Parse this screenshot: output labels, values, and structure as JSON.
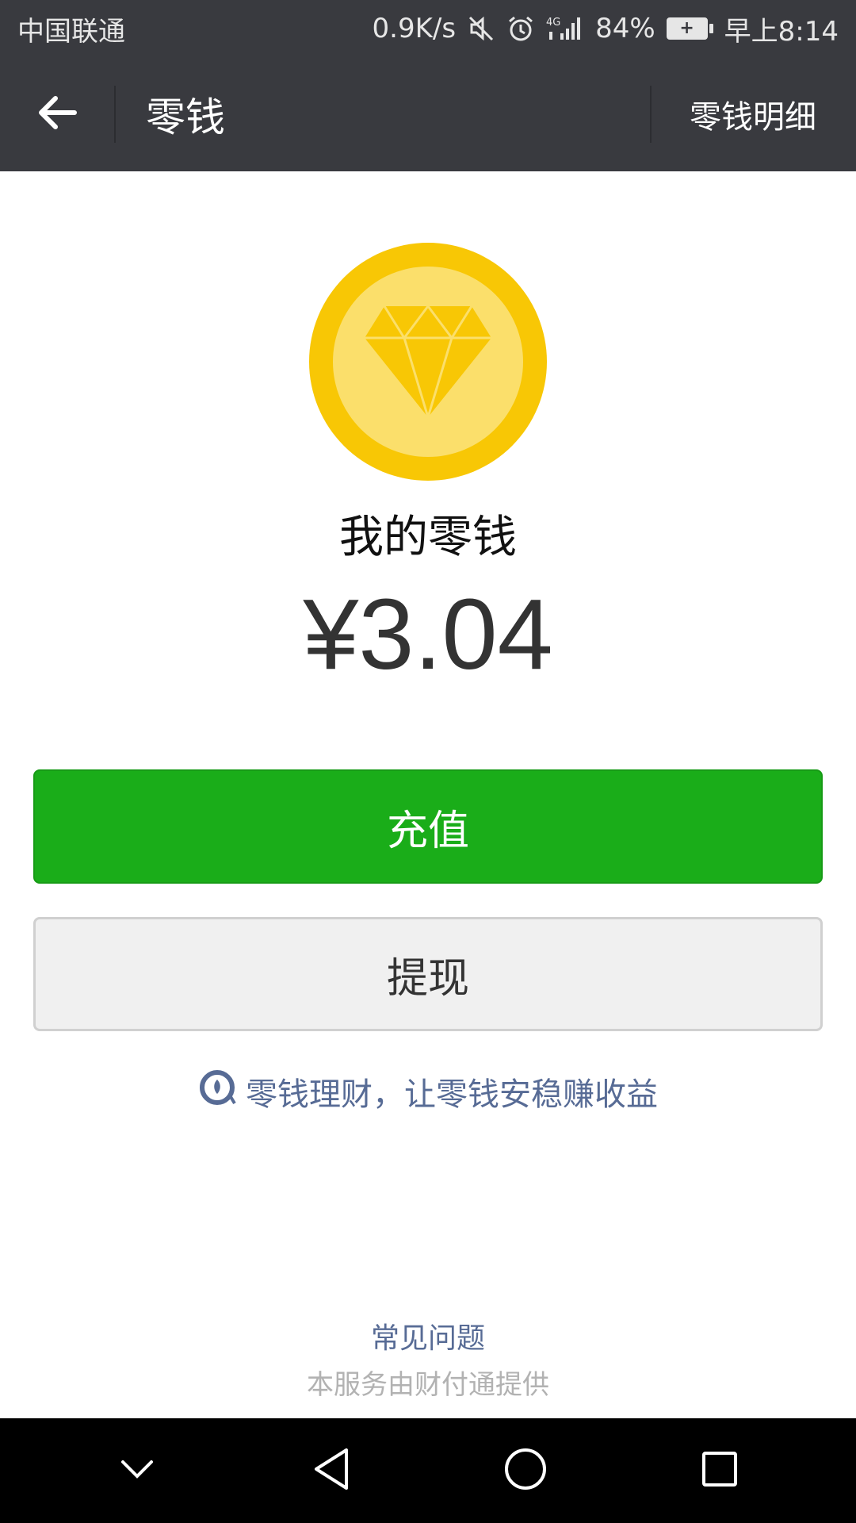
{
  "status_bar": {
    "carrier": "中国联通",
    "speed": "0.9K/s",
    "network": "4G",
    "battery_percent": "84%",
    "time": "早上8:14",
    "icons": [
      "mute-icon",
      "alarm-icon",
      "signal-icon",
      "battery-icon"
    ]
  },
  "header": {
    "title": "零钱",
    "detail_link": "零钱明细",
    "back_icon": "arrow-left-icon"
  },
  "wallet": {
    "icon": "diamond-coin-icon",
    "label": "我的零钱",
    "amount": "¥3.04"
  },
  "actions": {
    "recharge_label": "充值",
    "withdraw_label": "提现"
  },
  "finance": {
    "icon": "licaitong-icon",
    "text": "零钱理财，让零钱安稳赚收益"
  },
  "footer": {
    "faq": "常见问题",
    "provider": "本服务由财付通提供"
  },
  "nav": {
    "icons": [
      "chevron-down-icon",
      "back-triangle-icon",
      "home-circle-icon",
      "recents-square-icon"
    ]
  },
  "colors": {
    "bar_bg": "#393a3f",
    "primary_green": "#1aad19",
    "link_blue": "#576b95",
    "coin_outer": "#f8c705",
    "coin_inner": "#fbdf6b"
  }
}
